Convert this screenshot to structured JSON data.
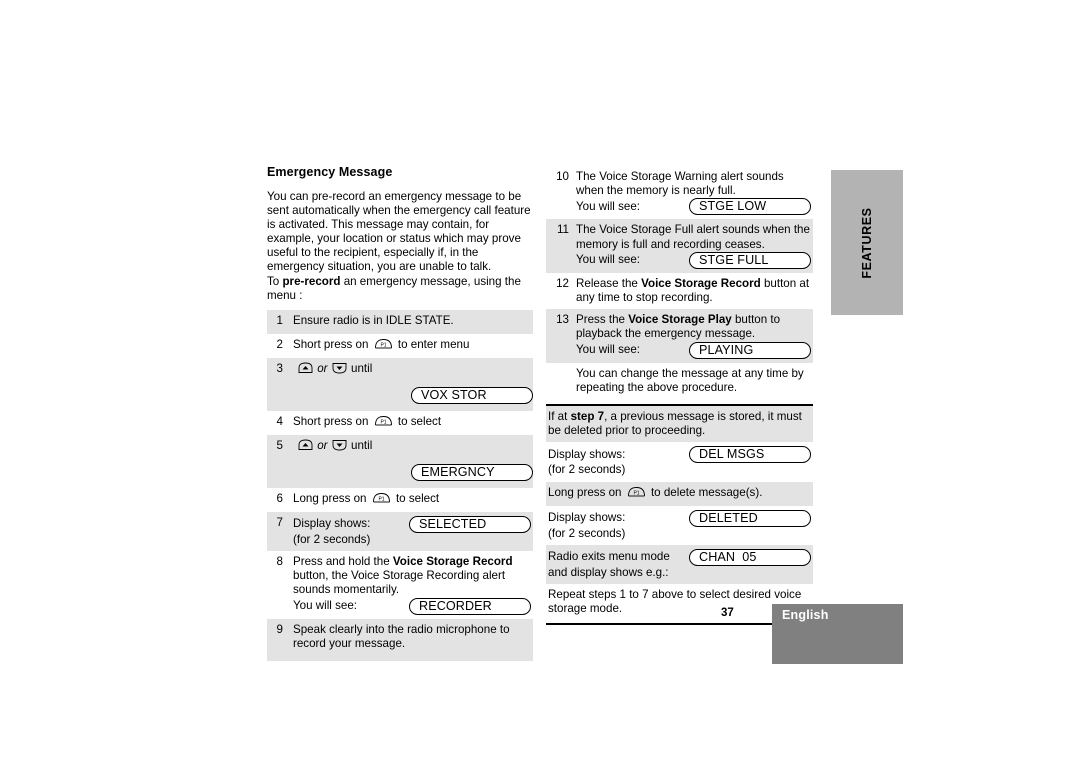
{
  "document": {
    "page_number": "37",
    "language_label": "English",
    "side_tab_label": "FEATURES"
  },
  "left_column": {
    "section_title": "Emergency Message",
    "intro_paragraph_lines": [
      "You can pre-record an emergency message to be",
      "sent automatically when the emergency call feature",
      "is activated. This message may contain, for",
      "example, your location or status which may prove",
      "useful to the recipient, especially if, in the",
      "emergency situation, you are unable to talk."
    ],
    "intro_lead_prefix": "To ",
    "intro_lead_bold": "pre-record",
    "intro_lead_suffix": " an emergency message, using the",
    "intro_lead_line2": "menu :",
    "steps": [
      {
        "number": "1",
        "shaded": true,
        "text": "Ensure radio is in IDLE STATE."
      },
      {
        "number": "2",
        "shaded": false,
        "text_before_icon": "Short press on",
        "icon": "p1-button-icon",
        "text_after_icon": "to enter menu"
      },
      {
        "number": "3",
        "shaded": true,
        "text_up_down": "or",
        "text_after": "until",
        "lcd": "VOX STOR"
      },
      {
        "number": "4",
        "shaded": false,
        "text_before_icon": "Short press on",
        "icon": "p1-button-icon",
        "text_after_icon": "to select"
      },
      {
        "number": "5",
        "shaded": true,
        "text_up_down": "or",
        "text_after": "until",
        "lcd": "EMERGNCY"
      },
      {
        "number": "6",
        "shaded": false,
        "text_before_icon": "Long press on",
        "icon": "p1-button-icon",
        "text_after_icon": "to select"
      },
      {
        "number": "7",
        "shaded": true,
        "line1": "Display shows:",
        "line2": "(for 2 seconds)",
        "lcd": "SELECTED"
      },
      {
        "number": "8",
        "shaded": false,
        "line1_prefix": "Press and hold the ",
        "line1_bold": "Voice Storage Record",
        "line2": "button, the Voice Storage Recording alert",
        "line3": "sounds momentarily.",
        "line4": "You will see:",
        "lcd": "RECORDER"
      },
      {
        "number": "9",
        "shaded": true,
        "line1": "Speak clearly into the radio microphone to",
        "line2": "record your message."
      }
    ]
  },
  "right_column": {
    "steps": [
      {
        "number": "10",
        "shaded": false,
        "line1": "The Voice Storage Warning alert sounds",
        "line2": "when the memory is nearly full.",
        "line3": "You will see:",
        "lcd": "STGE LOW"
      },
      {
        "number": "11",
        "shaded": true,
        "line1": "The Voice Storage Full alert sounds when the",
        "line2": "memory is full and recording ceases.",
        "line3": "You will see:",
        "lcd": "STGE FULL"
      },
      {
        "number": "12",
        "shaded": false,
        "line1_prefix": "Release the ",
        "line1_bold": "Voice Storage Record",
        "line1_suffix": " button at",
        "line2": "any time to stop recording."
      },
      {
        "number": "13",
        "shaded": true,
        "line1_prefix": "Press the ",
        "line1_bold": "Voice Storage Play",
        "line1_suffix": " button to",
        "line2": "playback the emergency message.",
        "line3": "You will see:",
        "lcd": "PLAYING"
      },
      {
        "number": "",
        "shaded": false,
        "line1": "You can change the message at any time by",
        "line2": "repeating the above procedure."
      }
    ],
    "note_block": {
      "line1_prefix": "If at ",
      "line1_bold": "step 7",
      "line1_suffix": ", a previous message is stored, it must",
      "line2": "be deleted prior to proceeding."
    },
    "delete_steps": [
      {
        "shaded": false,
        "line1": "Display shows:",
        "line2": "(for 2 seconds)",
        "lcd": "DEL MSGS"
      },
      {
        "shaded": true,
        "text_before_icon": "Long press on",
        "icon": "p1-button-icon",
        "text_after_icon": "to delete message(s)."
      },
      {
        "shaded": false,
        "line1": "Display shows:",
        "line2": "(for 2 seconds)",
        "lcd": "DELETED"
      },
      {
        "shaded": true,
        "line1": "Radio exits menu mode",
        "line2": "and display shows e.g.:",
        "lcd": "CHAN  05"
      },
      {
        "shaded": false,
        "line1": "Repeat steps 1 to 7 above to select desired voice",
        "line2": "storage mode."
      }
    ]
  },
  "colors": {
    "row_shade": "#e3e3e3",
    "side_tab": "#b3b3b3",
    "footer_band": "#808080"
  }
}
